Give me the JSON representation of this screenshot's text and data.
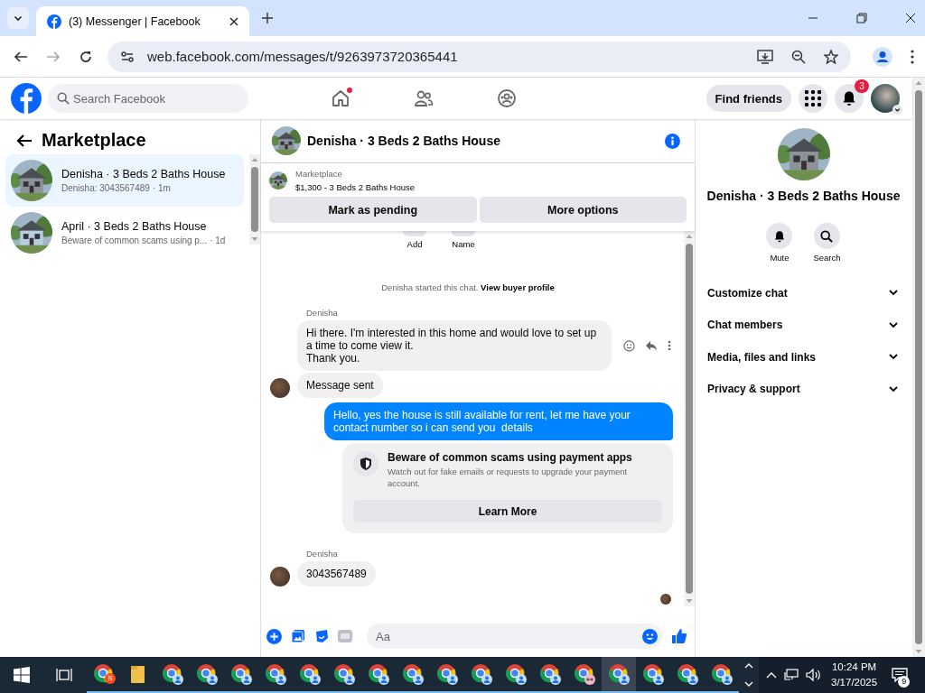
{
  "browser": {
    "tab_title": "(3) Messenger | Facebook",
    "url": "web.facebook.com/messages/t/9263973720365441"
  },
  "header": {
    "search_placeholder": "Search Facebook",
    "nav": [
      {
        "kind": "home",
        "dot": true
      },
      {
        "kind": "friends",
        "dot": false
      },
      {
        "kind": "groups",
        "dot": false
      }
    ],
    "find_friends": "Find friends",
    "notification_count": "3"
  },
  "sidebar": {
    "title": "Marketplace",
    "conversations": [
      {
        "title": "Denisha · 3 Beds 2 Baths House",
        "preview": "Denisha: 3043567489",
        "time": "· 1m",
        "selected": true
      },
      {
        "title": "April · 3 Beds 2 Baths House",
        "preview": "Beware of common scams using p...",
        "time": "· 1d",
        "selected": false
      }
    ]
  },
  "chat": {
    "title": "Denisha · 3 Beds 2 Baths House",
    "listing": {
      "label": "Marketplace",
      "title": "$1,300 - 3 Beds 2 Baths House"
    },
    "actions": [
      "Mark as pending",
      "More options"
    ],
    "quick_actions": [
      "Add",
      "Name"
    ],
    "system": {
      "text": "Denisha started this chat.",
      "link": "View buyer profile"
    },
    "messages": [
      {
        "kind": "incoming",
        "sender": "Denisha",
        "text": "Hi there. I'm interested in this home and would love to set up a time to come view it.\nThank you.",
        "avatar": false,
        "hover_actions": true
      },
      {
        "kind": "incoming",
        "text": "Message sent",
        "avatar": true,
        "hover_actions": false
      },
      {
        "kind": "outgoing",
        "text": "Hello, yes the house is still available for rent, let me have your contact number so i can send you  details"
      },
      {
        "kind": "notice",
        "title": "Beware of common scams using payment apps",
        "body": "Watch out for fake emails or requests to upgrade your payment account.",
        "button": "Learn More"
      },
      {
        "kind": "incoming",
        "sender": "Denisha",
        "text": "3043567489",
        "avatar": true,
        "hover_actions": false
      }
    ],
    "composer_placeholder": "Aa"
  },
  "details": {
    "title": "Denisha · 3 Beds 2 Baths House",
    "actions": [
      {
        "kind": "mute",
        "label": "Mute"
      },
      {
        "kind": "search",
        "label": "Search"
      }
    ],
    "sections": [
      {
        "label": "Customize chat",
        "expanded": false
      },
      {
        "label": "Chat members",
        "expanded": false
      },
      {
        "label": "Media, files and links",
        "expanded": false
      },
      {
        "label": "Privacy & support",
        "expanded": false
      }
    ]
  },
  "taskbar": {
    "apps": [
      {
        "kind": "chrome-badge",
        "badge": "S",
        "selected": false
      },
      {
        "kind": "folder",
        "selected": false
      },
      {
        "kind": "chrome",
        "selected": false
      },
      {
        "kind": "chrome",
        "selected": false
      },
      {
        "kind": "chrome",
        "selected": false
      },
      {
        "kind": "chrome",
        "selected": false
      },
      {
        "kind": "chrome",
        "selected": false
      },
      {
        "kind": "chrome",
        "selected": false
      },
      {
        "kind": "chrome",
        "selected": false
      },
      {
        "kind": "chrome",
        "selected": false
      },
      {
        "kind": "chrome",
        "selected": false
      },
      {
        "kind": "chrome",
        "selected": false
      },
      {
        "kind": "chrome",
        "selected": false
      },
      {
        "kind": "chrome",
        "selected": false
      },
      {
        "kind": "chrome-pink",
        "selected": false
      },
      {
        "kind": "chrome",
        "selected": true
      },
      {
        "kind": "chrome",
        "selected": false
      },
      {
        "kind": "chrome",
        "selected": false
      },
      {
        "kind": "chrome",
        "selected": false
      }
    ],
    "time": "10:24 PM",
    "date": "3/17/2025",
    "notifications": "9"
  }
}
